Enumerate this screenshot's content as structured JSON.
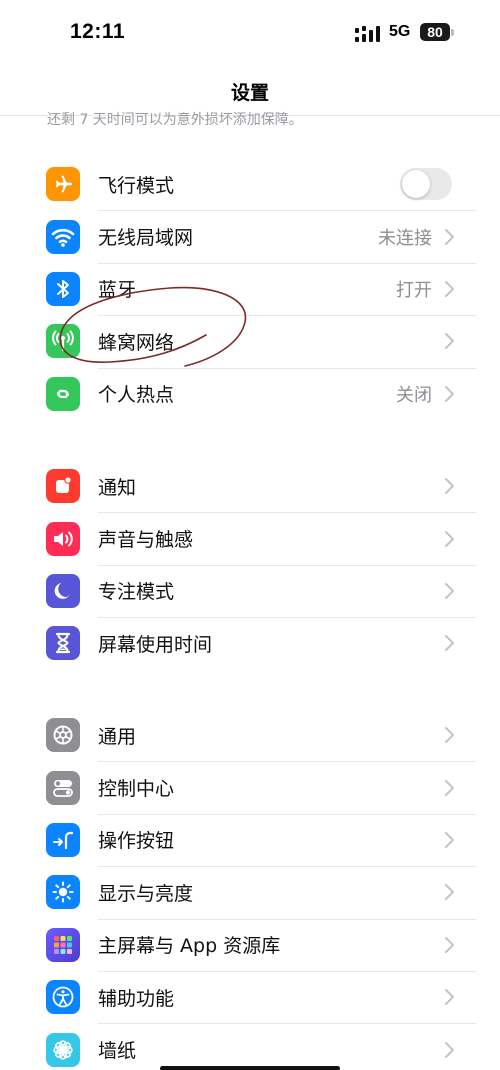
{
  "status_bar": {
    "time": "12:11",
    "network": "5G",
    "battery": "80"
  },
  "nav": {
    "title": "设置"
  },
  "hint": {
    "text": "还剩 7 天时间可以为意外损坏添加保障。"
  },
  "groups": [
    {
      "items": [
        {
          "label": "飞行模式",
          "icon": "airplane-icon",
          "icon_color": "#FF9500",
          "control": "toggle",
          "toggle_on": false
        },
        {
          "label": "无线局域网",
          "icon": "wifi-icon",
          "icon_color": "#0A84FF",
          "value": "未连接"
        },
        {
          "label": "蓝牙",
          "icon": "bluetooth-icon",
          "icon_color": "#0A84FF",
          "value": "打开"
        },
        {
          "label": "蜂窝网络",
          "icon": "cellular-icon",
          "icon_color": "#34C759",
          "value": ""
        },
        {
          "label": "个人热点",
          "icon": "hotspot-icon",
          "icon_color": "#34C759",
          "value": "关闭"
        }
      ]
    },
    {
      "items": [
        {
          "label": "通知",
          "icon": "notification-icon",
          "icon_color": "#FF3B30"
        },
        {
          "label": "声音与触感",
          "icon": "sound-icon",
          "icon_color": "#FF2D55"
        },
        {
          "label": "专注模式",
          "icon": "moon-icon",
          "icon_color": "#5856D6"
        },
        {
          "label": "屏幕使用时间",
          "icon": "hourglass-icon",
          "icon_color": "#5856D6"
        }
      ]
    },
    {
      "items": [
        {
          "label": "通用",
          "icon": "gear-icon",
          "icon_color": "#8E8E93"
        },
        {
          "label": "控制中心",
          "icon": "control-center-icon",
          "icon_color": "#8E8E93"
        },
        {
          "label": "操作按钮",
          "icon": "action-button-icon",
          "icon_color": "#0A84FF"
        },
        {
          "label": "显示与亮度",
          "icon": "brightness-icon",
          "icon_color": "#0A84FF"
        },
        {
          "label": "主屏幕与 App 资源库",
          "icon": "home-screen-icon",
          "icon_color": "#5856D6"
        },
        {
          "label": "辅助功能",
          "icon": "accessibility-icon",
          "icon_color": "#0A84FF"
        },
        {
          "label": "墙纸",
          "icon": "wallpaper-icon",
          "icon_color": "#34C7E8"
        }
      ]
    }
  ],
  "colors": {
    "separator": "#E8E8EC",
    "secondary_text": "#8E8E93",
    "scribble": "#7A2A2A"
  }
}
